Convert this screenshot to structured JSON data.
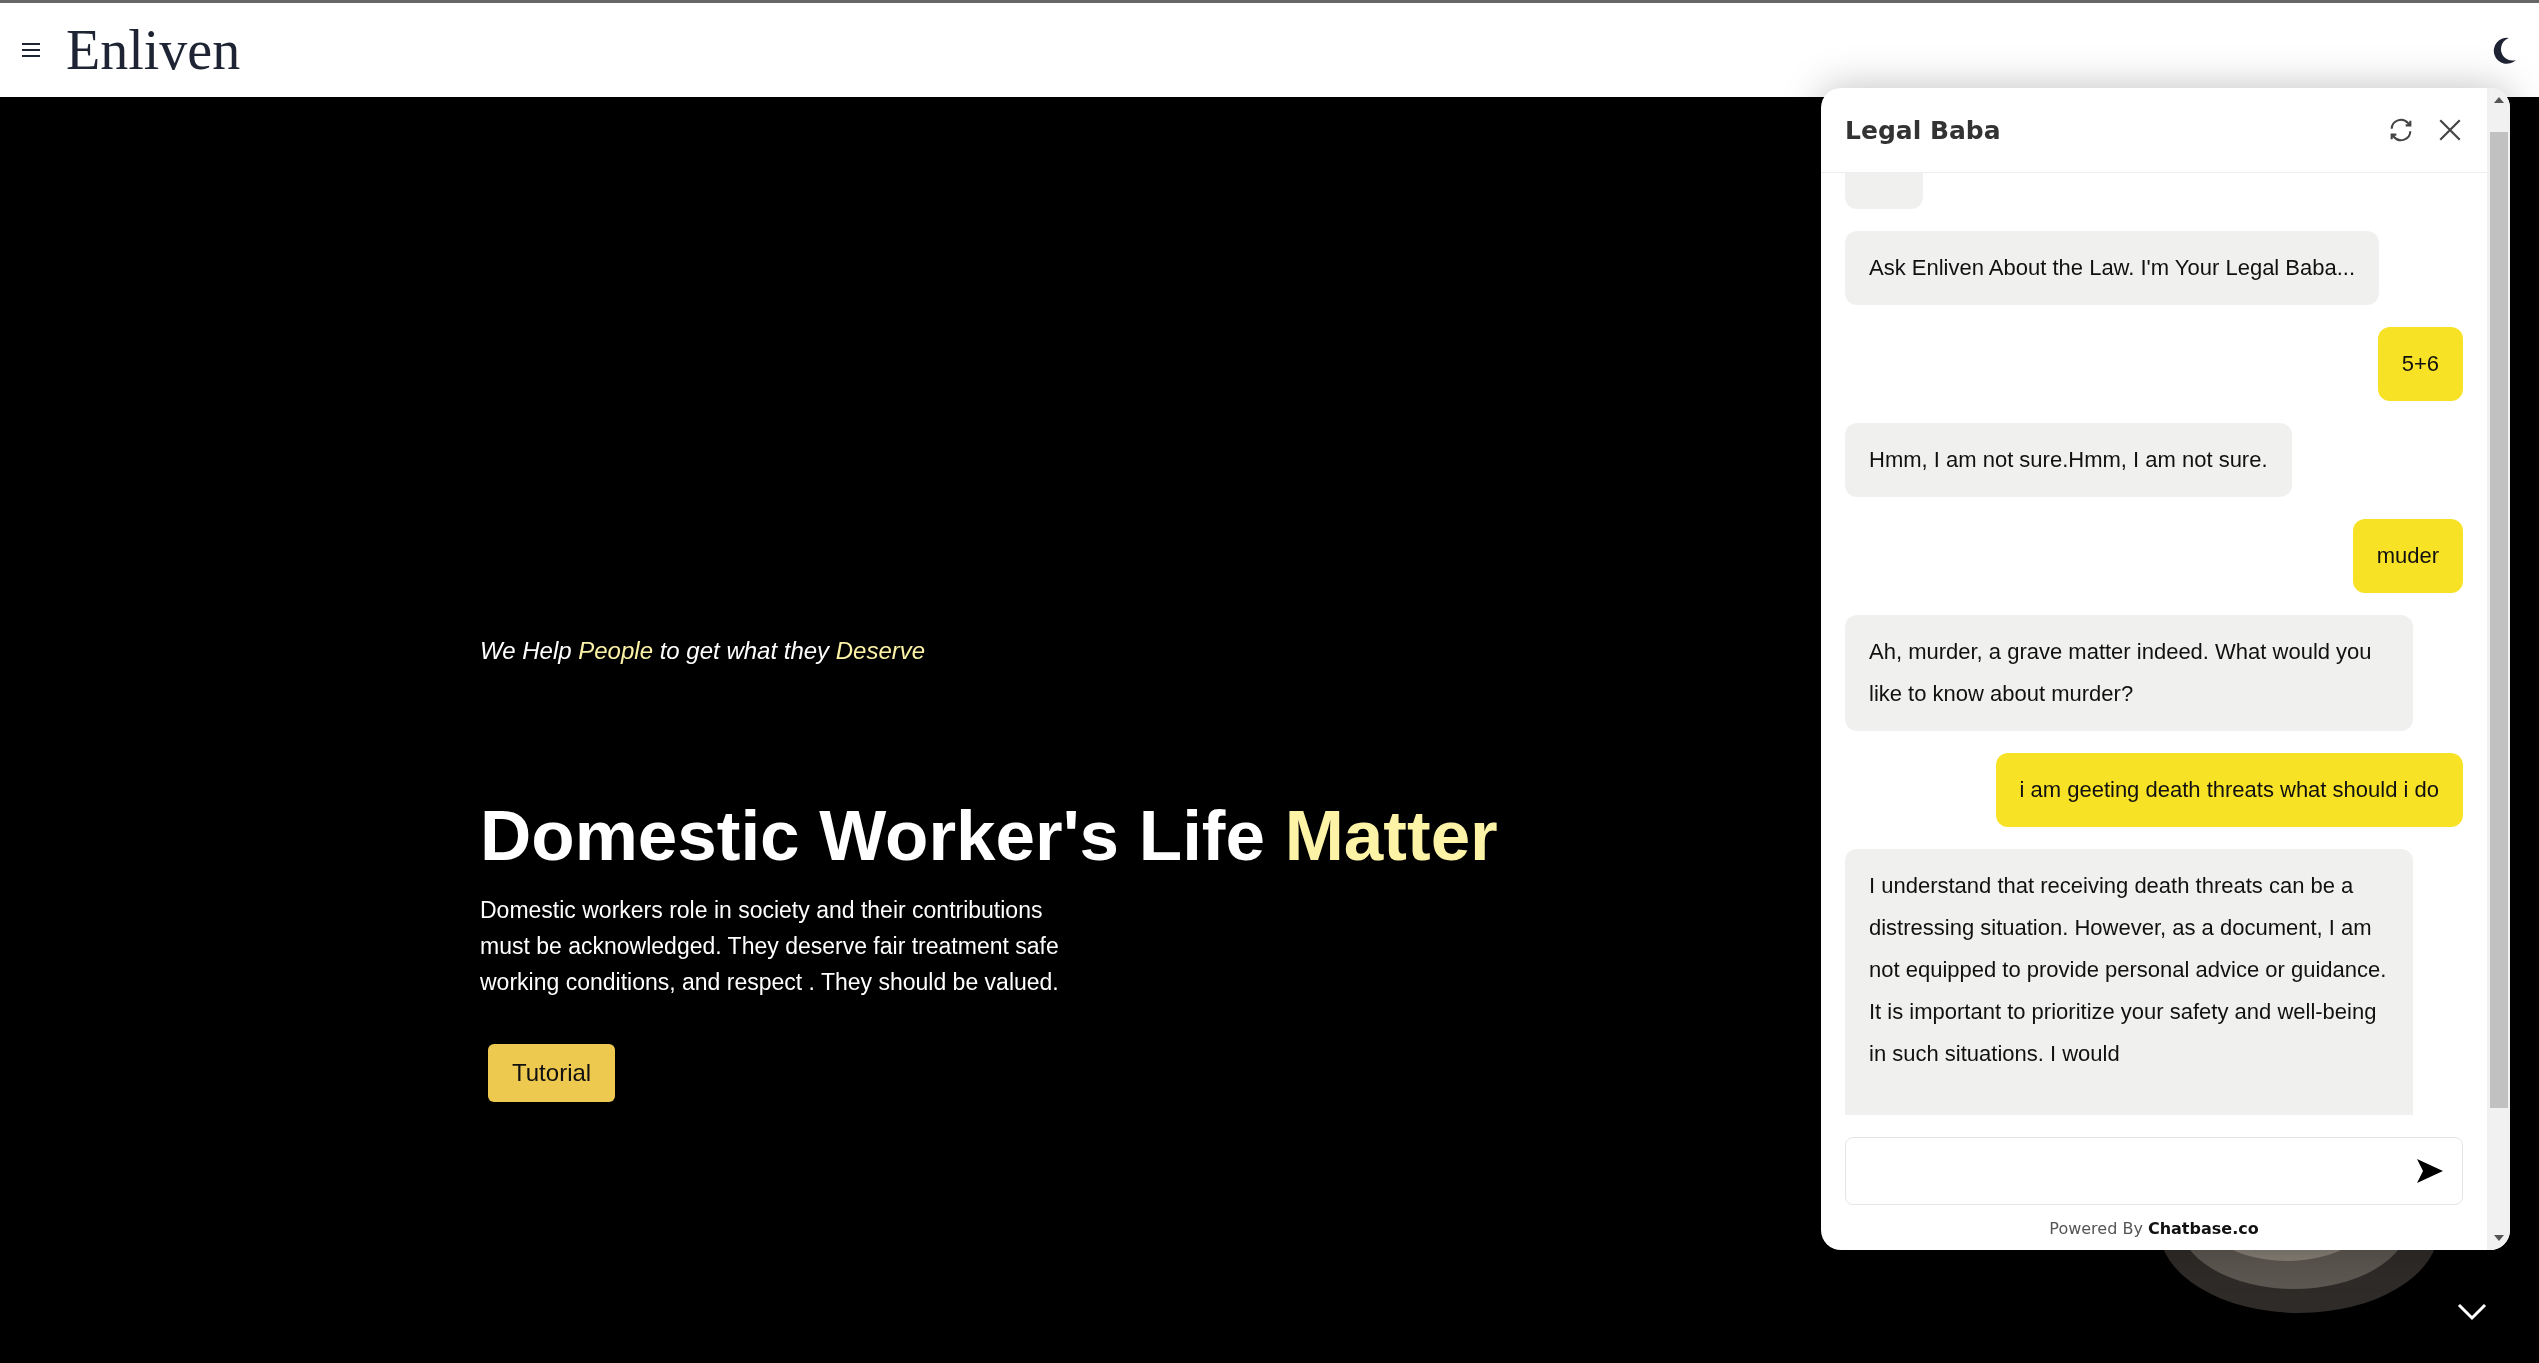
{
  "header": {
    "title": "Enliven"
  },
  "hero": {
    "tagline": [
      {
        "text": "We Help ",
        "highlight": false
      },
      {
        "text": "People",
        "highlight": true
      },
      {
        "text": " to get what they ",
        "highlight": false
      },
      {
        "text": "Deserve",
        "highlight": true
      }
    ],
    "headline": [
      {
        "text": "Domestic Worker's Life ",
        "highlight": false
      },
      {
        "text": "Matter",
        "highlight": true
      }
    ],
    "body": "Domestic workers role in society and their contributions must be acknowledged. They deserve fair treatment safe working conditions, and respect . They should be valued.",
    "button": "Tutorial"
  },
  "chat": {
    "title": "Legal Baba",
    "messages": [
      {
        "kind": "bot",
        "clipped": true
      },
      {
        "kind": "bot",
        "text": "Ask Enliven About the Law. I'm Your Legal Baba..."
      },
      {
        "kind": "user",
        "text": "5+6"
      },
      {
        "kind": "bot",
        "text": "Hmm, I am not sure.Hmm, I am not sure."
      },
      {
        "kind": "user",
        "text": "muder"
      },
      {
        "kind": "bot",
        "text": "Ah, murder, a grave matter indeed. What would you like to know about murder?"
      },
      {
        "kind": "user",
        "text": "i am geeting death threats what should i do"
      },
      {
        "kind": "bot",
        "text": "I understand that receiving death threats can be a distressing situation. However, as a document, I am not equipped to provide personal advice or guidance. It is important to prioritize your safety and well-being in such situations. I would",
        "clipped": true
      }
    ],
    "footer": "Powered By **Chatbase.co**"
  }
}
